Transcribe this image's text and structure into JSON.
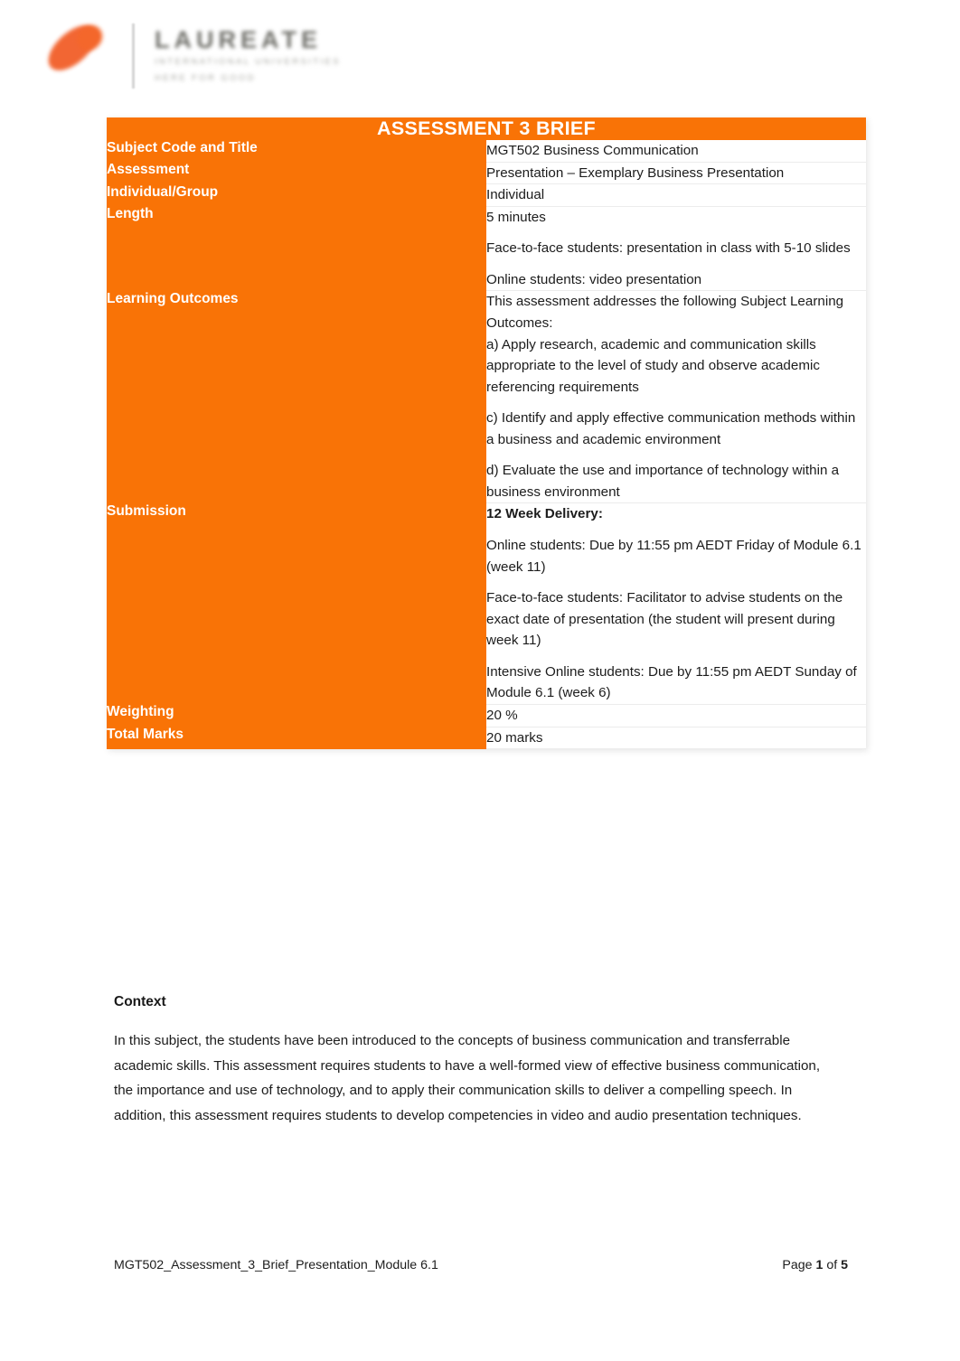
{
  "logo": {
    "wordmark": "LAUREATE",
    "subline_1": "INTERNATIONAL UNIVERSITIES",
    "subline_2": "HERE FOR GOOD"
  },
  "table": {
    "title": "ASSESSMENT 3 BRIEF",
    "rows": [
      {
        "label": "Subject Code and Title",
        "lines": [
          "MGT502 Business Communication"
        ]
      },
      {
        "label": "Assessment",
        "lines": [
          "Presentation – Exemplary Business Presentation"
        ]
      },
      {
        "label": "Individual/Group",
        "lines": [
          "Individual"
        ]
      },
      {
        "label": "Length",
        "lines": [
          "5 minutes",
          "Face-to-face students: presentation in class with 5-10 slides",
          "Online students: video presentation"
        ]
      },
      {
        "label": "Learning Outcomes",
        "lines": [
          "This assessment addresses the following Subject Learning Outcomes:",
          "a) Apply research, academic and communication skills appropriate to the level of study and observe academic referencing requirements",
          "c) Identify and apply effective communication methods within a business and academic environment",
          "d) Evaluate the use and importance of technology within a business environment"
        ]
      },
      {
        "label": "Submission",
        "lines": [
          "12 Week Delivery:",
          "Online students: Due by 11:55 pm AEDT Friday of Module 6.1 (week 11)",
          "Face-to-face students: Facilitator to advise students on the exact date of presentation (the student will present during week 11)",
          "Intensive Online students: Due by 11:55 pm AEDT Sunday of Module 6.1 (week 6)"
        ]
      },
      {
        "label": "Weighting",
        "lines": [
          "20 %"
        ]
      },
      {
        "label": "Total Marks",
        "lines": [
          "20 marks"
        ]
      }
    ]
  },
  "context": {
    "heading": "Context",
    "body": "In this subject, the students have been introduced to the concepts of business communication and transferrable academic skills. This assessment requires students to have a well-formed view of effective business communication, the importance and use of technology, and to apply their communication skills to deliver a compelling speech. In addition, this assessment requires students to develop competencies in video and audio presentation techniques."
  },
  "footer": {
    "document_name": "MGT502_Assessment_3_Brief_Presentation_Module 6.1",
    "page_prefix": "Page ",
    "page_current": "1",
    "page_middle": " of ",
    "page_total": "5"
  },
  "colors": {
    "brand_orange": "#f97306",
    "logo_orange": "#f15a22",
    "text": "#1c1c1c"
  }
}
